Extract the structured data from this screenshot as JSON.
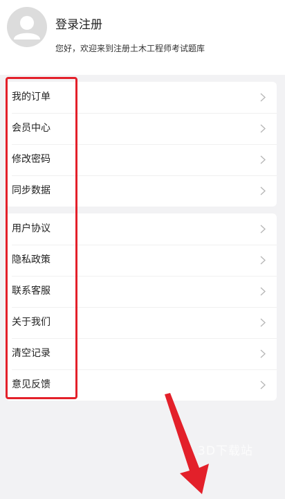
{
  "header": {
    "login_title": "登录注册",
    "welcome_text": "您好，欢迎来到注册土木工程师考试题库"
  },
  "menu_group_1": [
    {
      "label": "我的订单"
    },
    {
      "label": "会员中心"
    },
    {
      "label": "修改密码"
    },
    {
      "label": "同步数据"
    }
  ],
  "menu_group_2": [
    {
      "label": "用户协议"
    },
    {
      "label": "隐私政策"
    },
    {
      "label": "联系客服"
    },
    {
      "label": "关于我们"
    },
    {
      "label": "清空记录"
    },
    {
      "label": "意见反馈"
    }
  ],
  "watermark": "3D下载站",
  "colors": {
    "highlight": "#e3202a",
    "background": "#f2f2f4",
    "chevron": "#b5b5b5"
  },
  "icons": {
    "avatar": "user-avatar-icon",
    "row_chevron": "chevron-right-icon"
  }
}
